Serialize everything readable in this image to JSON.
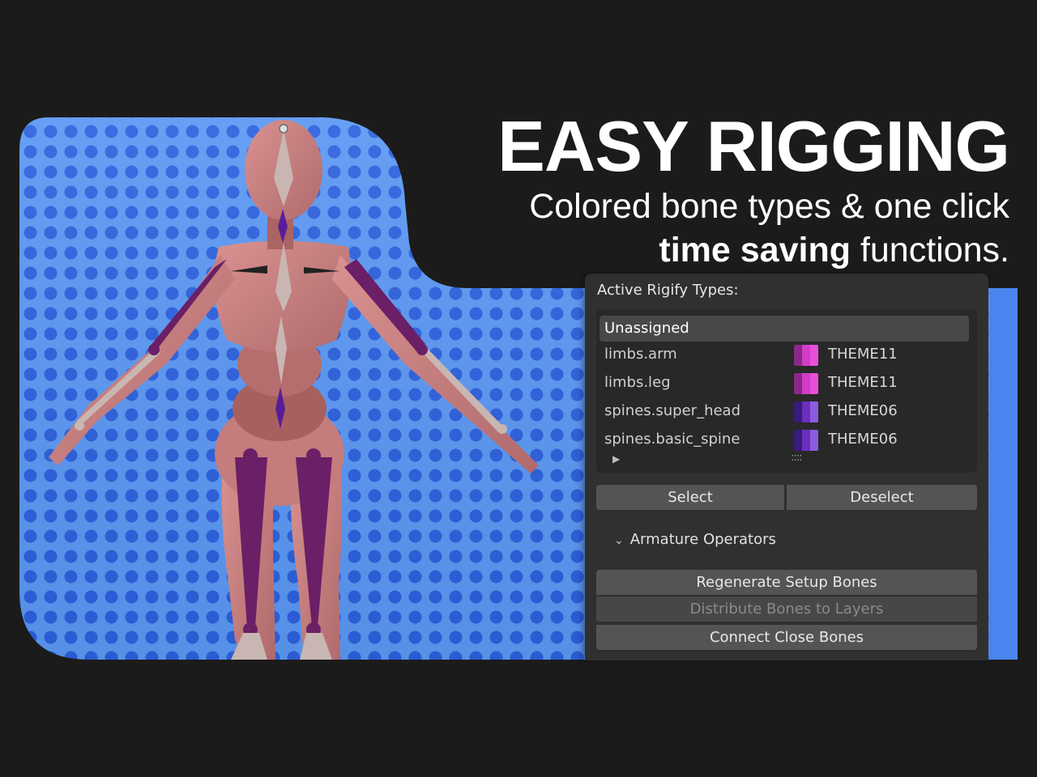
{
  "headline": {
    "title": "EASY RIGGING",
    "subtitle_line1": "Colored bone types & one click",
    "subtitle_bold": "time saving",
    "subtitle_rest": " functions."
  },
  "panel": {
    "title": "Active Rigify Types:",
    "rows": [
      {
        "name": "Unassigned",
        "theme": "",
        "colors": []
      },
      {
        "name": "limbs.arm",
        "theme": "THEME11",
        "colors": [
          "#8a2a86",
          "#d13cc8",
          "#e84fd8"
        ]
      },
      {
        "name": "limbs.leg",
        "theme": "THEME11",
        "colors": [
          "#8a2a86",
          "#d13cc8",
          "#e84fd8"
        ]
      },
      {
        "name": "spines.super_head",
        "theme": "THEME06",
        "colors": [
          "#3a1a7a",
          "#6a2fc0",
          "#8f5ae0"
        ]
      },
      {
        "name": "spines.basic_spine",
        "theme": "THEME06",
        "colors": [
          "#3a1a7a",
          "#6a2fc0",
          "#8f5ae0"
        ]
      }
    ],
    "expand_icon": "▶",
    "grip_icon": "::::",
    "select_label": "Select",
    "deselect_label": "Deselect",
    "section_label": "Armature Operators",
    "section_icon": "⌄",
    "ops": [
      {
        "label": "Regenerate Setup Bones",
        "enabled": true
      },
      {
        "label": "Distribute Bones to Layers",
        "enabled": false
      },
      {
        "label": "Connect Close Bones",
        "enabled": true
      }
    ]
  },
  "colors": {
    "background": "#1b1b1b",
    "stage_blue": "#4f8df0",
    "dot_blue": "#2d63e0",
    "skin": "#c77f7f",
    "bone_purple": "#6b1f66"
  }
}
